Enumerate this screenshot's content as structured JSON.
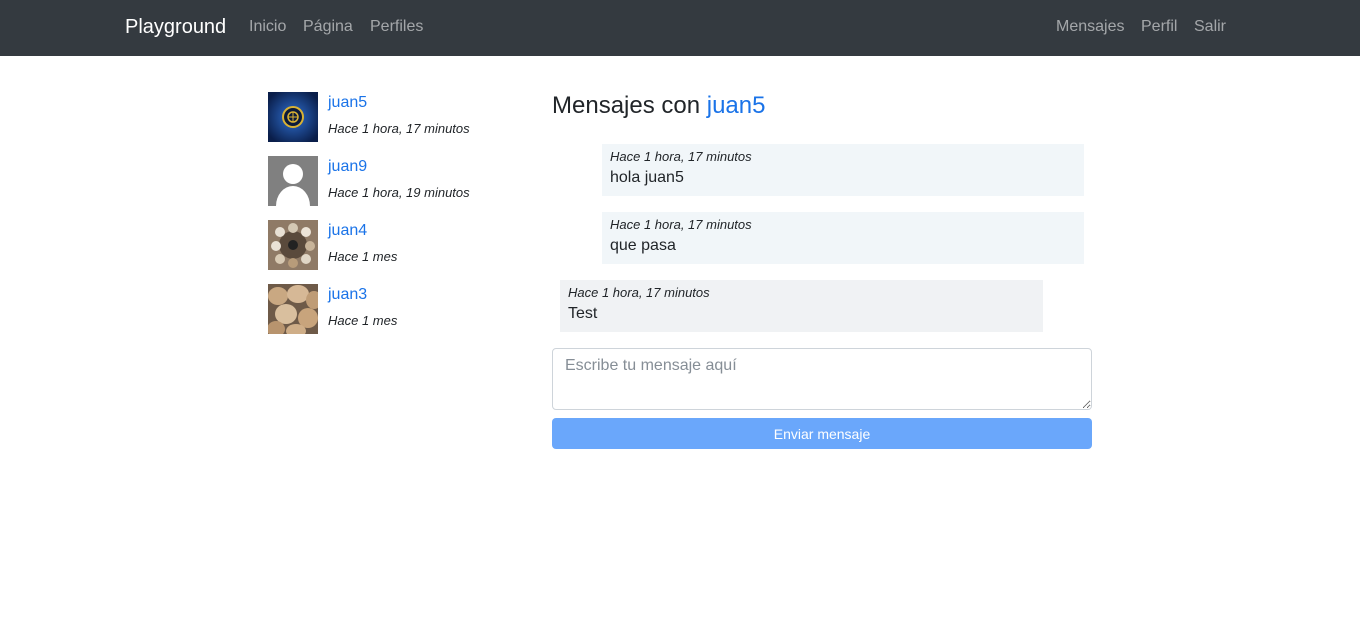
{
  "navbar": {
    "brand": "Playground",
    "left_links": [
      "Inicio",
      "Página",
      "Perfiles"
    ],
    "right_links": [
      "Mensajes",
      "Perfil",
      "Salir"
    ]
  },
  "threads": [
    {
      "name": "juan5",
      "time": "Hace 1 hora, 17 minutos",
      "avatar": "soccer-crest-avatar"
    },
    {
      "name": "juan9",
      "time": "Hace 1 hora, 19 minutos",
      "avatar": "default-user-avatar"
    },
    {
      "name": "juan4",
      "time": "Hace 1 mes",
      "avatar": "food-plates-photo-avatar"
    },
    {
      "name": "juan3",
      "time": "Hace 1 mes",
      "avatar": "bread-photo-avatar"
    }
  ],
  "conversation": {
    "title_prefix": "Mensajes con",
    "partner": "juan5",
    "messages": [
      {
        "time": "Hace 1 hora, 17 minutos",
        "text": "hola juan5",
        "mine": true
      },
      {
        "time": "Hace 1 hora, 17 minutos",
        "text": "que pasa",
        "mine": true
      },
      {
        "time": "Hace 1 hora, 17 minutos",
        "text": "Test",
        "mine": false
      }
    ]
  },
  "composer": {
    "placeholder": "Escribe tu mensaje aquí",
    "value": "",
    "send_label": "Enviar mensaje"
  },
  "colors": {
    "navbar_bg": "#343a40",
    "link": "#1a73e8",
    "send_button": "#6aa7fb",
    "own_message_bg": "#f1f6f9",
    "other_message_bg": "#f0f2f4"
  }
}
